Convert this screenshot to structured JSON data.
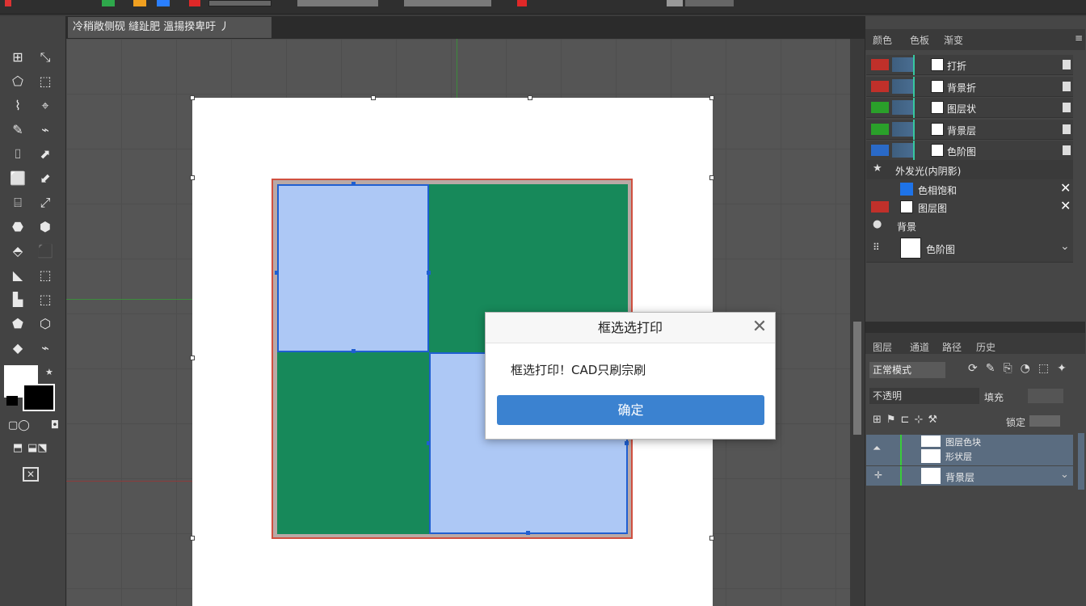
{
  "document": {
    "tab_title": "冷稍敞侧砚 縫趾肥 溫揚揆卑吁 丿"
  },
  "layers_panel": {
    "tabs": [
      "颜色",
      "色板",
      "渐变"
    ],
    "layers": [
      {
        "name": "打折",
        "color": "#c0302a"
      },
      {
        "name": "背景折",
        "color": "#c0302a"
      },
      {
        "name": "图层状",
        "color": "#2aa02a"
      },
      {
        "name": "背景层",
        "color": "#2aa02a"
      },
      {
        "name": "色阶图",
        "color": "#2a6ac8"
      }
    ],
    "effects": [
      {
        "name": "外发光(内阴影)"
      },
      {
        "name": "色相饱和"
      },
      {
        "name": "图层图"
      },
      {
        "name": "背景"
      },
      {
        "name": "色阶图"
      }
    ]
  },
  "properties_panel": {
    "tabs": [
      "图层",
      "通道",
      "路径",
      "历史"
    ],
    "blend_mode": "正常模式",
    "opacity_label": "不透明",
    "fill_label": "填充",
    "lock_label": "锁定",
    "rows": [
      {
        "name": "图层色块"
      },
      {
        "name": "形状层"
      },
      {
        "name": "背景层"
      }
    ]
  },
  "dialog": {
    "title": "框选选打印",
    "message": "框选打印！CAD只刷宗刷",
    "confirm_label": "确定",
    "close_icon": "close-icon"
  },
  "colors": {
    "green": "#17895a",
    "blue_selection": "#adc8f5",
    "selection_border": "#1f5fd1",
    "accent_button": "#3b82d0"
  }
}
